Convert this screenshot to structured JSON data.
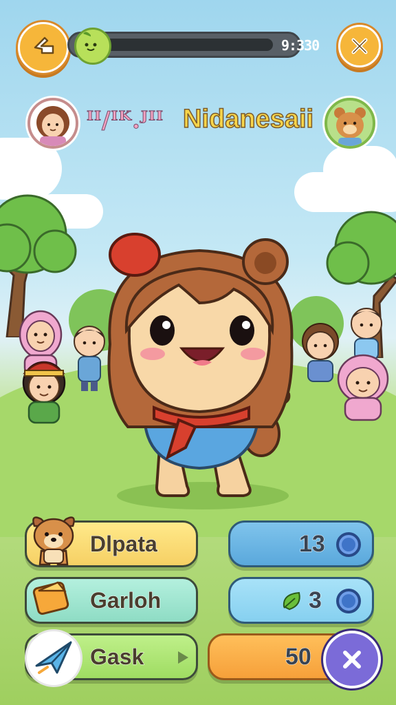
{
  "top_bar": {
    "timer": "9:330",
    "back_icon": "back-arrow-icon",
    "close_icon": "close-icon"
  },
  "title": {
    "part1": "ᴵᴵ/ᴵᴷ.ᴶᴵᴵ",
    "part2": "Nidanesaii"
  },
  "menu": {
    "items": [
      {
        "label": "Dlpata",
        "icon": "puppy-icon",
        "color": "#f6d86a"
      },
      {
        "label": "Garloh",
        "icon": "card-icon",
        "color": "#9fe4d0"
      },
      {
        "label": "Gask",
        "icon": "paper-plane-icon",
        "color": "#a9e26a"
      }
    ]
  },
  "stats": {
    "coins": "13",
    "leaves": "3",
    "energy": "50"
  },
  "colors": {
    "accent": "#f6b63a",
    "sky": "#9fd6ee",
    "grass": "#9fcf5f",
    "energy_bar": "#f6a03a",
    "close_purple": "#7b6bd8"
  }
}
